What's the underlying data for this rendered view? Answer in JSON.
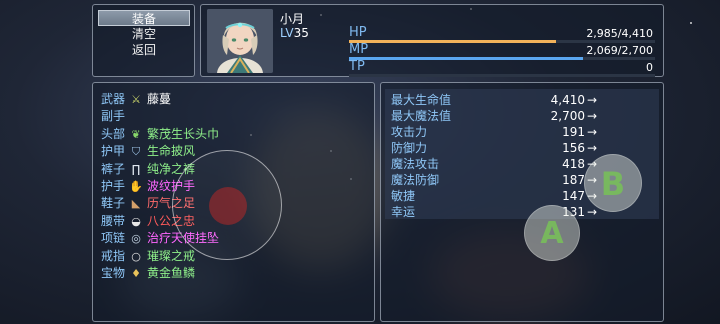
{
  "command_menu": {
    "items": [
      {
        "label": "装备",
        "selected": true
      },
      {
        "label": "清空",
        "selected": false
      },
      {
        "label": "返回",
        "selected": false
      }
    ]
  },
  "actor": {
    "name": "小月",
    "level_prefix": "LV",
    "level": "35",
    "hp": {
      "label": "HP",
      "text": "2,985/4,410",
      "fraction": 0.677,
      "color": "#f2b25a"
    },
    "mp": {
      "label": "MP",
      "text": "2,069/2,700",
      "fraction": 0.766,
      "color": "#5aa6f0"
    },
    "tp": {
      "label": "TP",
      "text": "0",
      "fraction": 0.0,
      "color": "#7fd36a"
    }
  },
  "equipment": [
    {
      "slot": "武器",
      "icon": "sword-icon",
      "glyph": "⚔",
      "glyph_color": "#c9d46a",
      "name": "藤蔓",
      "color": "#ffffff"
    },
    {
      "slot": "副手",
      "icon": "",
      "glyph": "",
      "glyph_color": "",
      "name": "",
      "color": "#ffffff"
    },
    {
      "slot": "头部",
      "icon": "leaf-icon",
      "glyph": "❦",
      "glyph_color": "#86d66a",
      "name": "繁茂生长头巾",
      "color": "#8ff08a"
    },
    {
      "slot": "护甲",
      "icon": "cloak-icon",
      "glyph": "⛉",
      "glyph_color": "#9fc4e8",
      "name": "生命披风",
      "color": "#8ff08a"
    },
    {
      "slot": "裤子",
      "icon": "pants-icon",
      "glyph": "∏",
      "glyph_color": "#dfe6ee",
      "name": "纯净之裤",
      "color": "#8ff08a"
    },
    {
      "slot": "护手",
      "icon": "gauntlet-icon",
      "glyph": "✋",
      "glyph_color": "#e2c9a6",
      "name": "波纹护手",
      "color": "#ff66ff"
    },
    {
      "slot": "鞋子",
      "icon": "boot-icon",
      "glyph": "◣",
      "glyph_color": "#d4a06a",
      "name": "历气之足",
      "color": "#ff6b6b"
    },
    {
      "slot": "腰带",
      "icon": "belt-icon",
      "glyph": "◒",
      "glyph_color": "#e7e7e7",
      "name": "八公之忠",
      "color": "#ff5b5b"
    },
    {
      "slot": "项链",
      "icon": "necklace-icon",
      "glyph": "◎",
      "glyph_color": "#c8d8e8",
      "name": "治疗天使挂坠",
      "color": "#ff66ff"
    },
    {
      "slot": "戒指",
      "icon": "ring-icon",
      "glyph": "○",
      "glyph_color": "#e6e6e6",
      "name": "璀璨之戒",
      "color": "#8ff08a"
    },
    {
      "slot": "宝物",
      "icon": "treasure-icon",
      "glyph": "♦",
      "glyph_color": "#e8c25a",
      "name": "黄金鱼鳞",
      "color": "#8ff08a"
    }
  ],
  "params": [
    {
      "label": "最大生命值",
      "value": "4,410",
      "arrow": "→"
    },
    {
      "label": "最大魔法值",
      "value": "2,700",
      "arrow": "→"
    },
    {
      "label": "攻击力",
      "value": "191",
      "arrow": "→"
    },
    {
      "label": "防御力",
      "value": "156",
      "arrow": "→"
    },
    {
      "label": "魔法攻击",
      "value": "418",
      "arrow": "→"
    },
    {
      "label": "魔法防御",
      "value": "187",
      "arrow": "→"
    },
    {
      "label": "敏捷",
      "value": "147",
      "arrow": "→"
    },
    {
      "label": "幸运",
      "value": "131",
      "arrow": "→"
    }
  ],
  "virtual_buttons": {
    "a": "A",
    "b": "B"
  }
}
